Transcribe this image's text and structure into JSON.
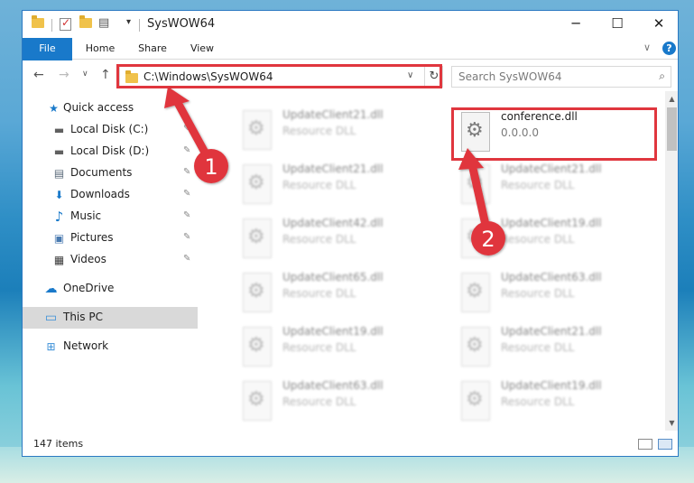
{
  "window": {
    "title": "SysWOW64",
    "minimize_glyph": "─",
    "maximize_glyph": "☐",
    "close_glyph": "✕"
  },
  "ribbon": {
    "tabs": [
      {
        "label": "File"
      },
      {
        "label": "Home"
      },
      {
        "label": "Share"
      },
      {
        "label": "View"
      }
    ],
    "expand_glyph": "∨",
    "help_glyph": "?"
  },
  "nav": {
    "back_glyph": "←",
    "forward_glyph": "→",
    "recent_glyph": "∨",
    "up_glyph": "↑"
  },
  "address_bar": {
    "path": "C:\\Windows\\SysWOW64",
    "dropdown_glyph": "∨",
    "refresh_glyph": "↻"
  },
  "search": {
    "placeholder": "Search SysWOW64",
    "icon_glyph": "⌕"
  },
  "sidebar": {
    "items": [
      {
        "label": "Quick access",
        "icon": "star-icon",
        "glyph": "★",
        "color": "#1979ca"
      },
      {
        "label": "Local Disk (C:)",
        "icon": "drive-icon",
        "glyph": "▬",
        "color": "#606060"
      },
      {
        "label": "Local Disk (D:)",
        "icon": "drive-icon",
        "glyph": "▬",
        "color": "#606060"
      },
      {
        "label": "Documents",
        "icon": "documents-icon",
        "glyph": "▤",
        "color": "#5a6a7a"
      },
      {
        "label": "Downloads",
        "icon": "download-icon",
        "glyph": "⬇",
        "color": "#1979ca"
      },
      {
        "label": "Music",
        "icon": "music-icon",
        "glyph": "♪",
        "color": "#1979ca"
      },
      {
        "label": "Pictures",
        "icon": "pictures-icon",
        "glyph": "▣",
        "color": "#4a7ab0"
      },
      {
        "label": "Videos",
        "icon": "videos-icon",
        "glyph": "▦",
        "color": "#3a3a3a"
      },
      {
        "label": "OneDrive",
        "icon": "cloud-icon",
        "glyph": "☁",
        "color": "#1979ca"
      },
      {
        "label": "This PC",
        "icon": "computer-icon",
        "glyph": "▭",
        "color": "#3a8fd8"
      },
      {
        "label": "Network",
        "icon": "network-icon",
        "glyph": "⊞",
        "color": "#3a8fd8"
      }
    ],
    "pin_glyph": "✎"
  },
  "files": [
    {
      "name": "UpdateClient21.dll",
      "desc": "Resource DLL"
    },
    {
      "name": "conference.dll",
      "desc": "0.0.0.0"
    },
    {
      "name": "UpdateClient21.dll",
      "desc": "Resource DLL"
    },
    {
      "name": "UpdateClient21.dll",
      "desc": "Resource DLL"
    },
    {
      "name": "UpdateClient42.dll",
      "desc": "Resource DLL"
    },
    {
      "name": "UpdateClient19.dll",
      "desc": "Resource DLL"
    },
    {
      "name": "UpdateClient65.dll",
      "desc": "Resource DLL"
    },
    {
      "name": "UpdateClient63.dll",
      "desc": "Resource DLL"
    },
    {
      "name": "UpdateClient19.dll",
      "desc": "Resource DLL"
    },
    {
      "name": "UpdateClient21.dll",
      "desc": "Resource DLL"
    },
    {
      "name": "UpdateClient63.dll",
      "desc": "Resource DLL"
    },
    {
      "name": "UpdateClient19.dll",
      "desc": "Resource DLL"
    }
  ],
  "status": {
    "item_count": "147 items"
  },
  "annotations": {
    "step1": "1",
    "step2": "2",
    "color": "#e0363e"
  },
  "scrollbar": {
    "up_glyph": "▲",
    "down_glyph": "▼"
  },
  "file_icon_glyph": "⚙"
}
